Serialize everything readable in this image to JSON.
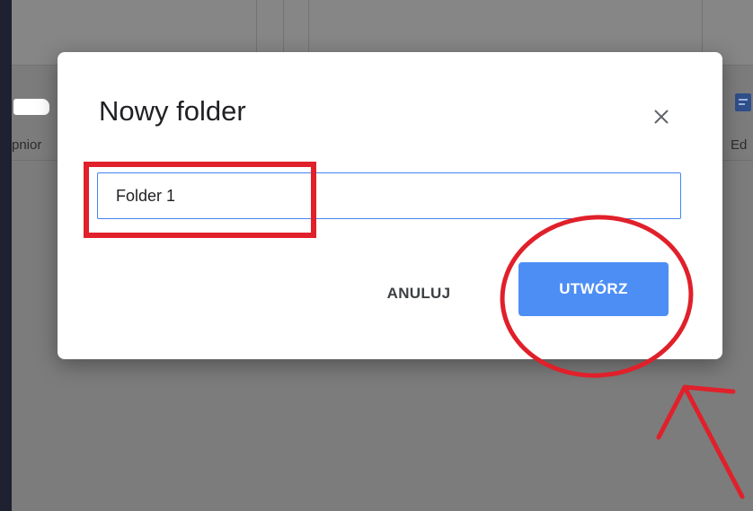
{
  "background": {
    "left_label": "pnior",
    "right_label": "Ed",
    "doc_icon": "document-icon"
  },
  "dialog": {
    "title": "Nowy folder",
    "close_icon": "close-icon",
    "input": {
      "value": "Folder 1",
      "placeholder": ""
    },
    "cancel_label": "ANULUJ",
    "create_label": "UTWÓRZ"
  },
  "colors": {
    "primary_button": "#4d8ef5",
    "input_focus_border": "#4285f4",
    "annotation_red": "#e0202a",
    "overlay_bg": "#7c7c7c"
  },
  "annotations": {
    "input_highlight": "red-rectangle",
    "button_highlight": "red-ellipse",
    "pointer": "red-arrow"
  }
}
